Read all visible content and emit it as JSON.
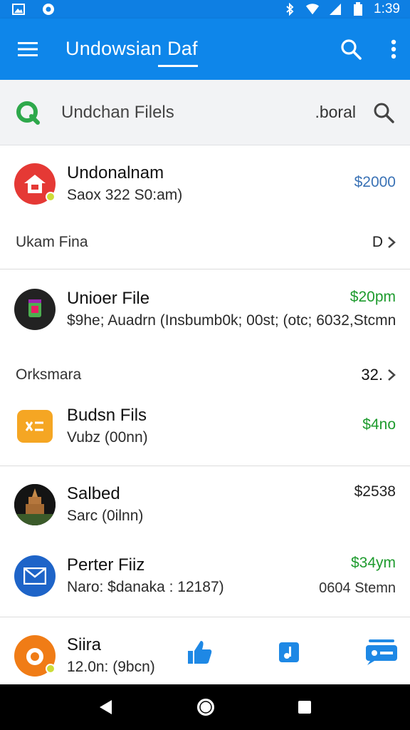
{
  "status_bar": {
    "time": "1:39"
  },
  "app_bar": {
    "title": "Undowsian Daf"
  },
  "search": {
    "text": "Undchan Filels",
    "filter": ".boral"
  },
  "items": [
    {
      "title": "Undonalnam",
      "subtitle": "Saox 322 S0:am)",
      "amount": "$2000"
    },
    {
      "title": "Unioer File",
      "subtitle": "$9he; Auadrn (Insbumb0k; 00st; (otc; 6032,Stcmn",
      "amount": "$20pm"
    },
    {
      "title": "Budsn Fils",
      "subtitle": "Vubz (00nn)",
      "amount": "$4no"
    },
    {
      "title": "Salbed",
      "subtitle": "Sarc (0ilnn)",
      "amount": "$2538"
    },
    {
      "title": "Perter Fiiz",
      "subtitle": "Naro: $danaka : 12187)",
      "amount": "$34ym",
      "secondary": "0604 Stemn"
    },
    {
      "title": "Siira",
      "subtitle": "12.0n: (9bcn)"
    }
  ],
  "sections": [
    {
      "label": "Ukam Fina",
      "value": "D"
    },
    {
      "label": "Orksmara",
      "value": "32."
    }
  ],
  "colors": {
    "app_bar": "#0e86ea",
    "green": "#1e9b2e",
    "blue_amount": "#3a72b5"
  }
}
